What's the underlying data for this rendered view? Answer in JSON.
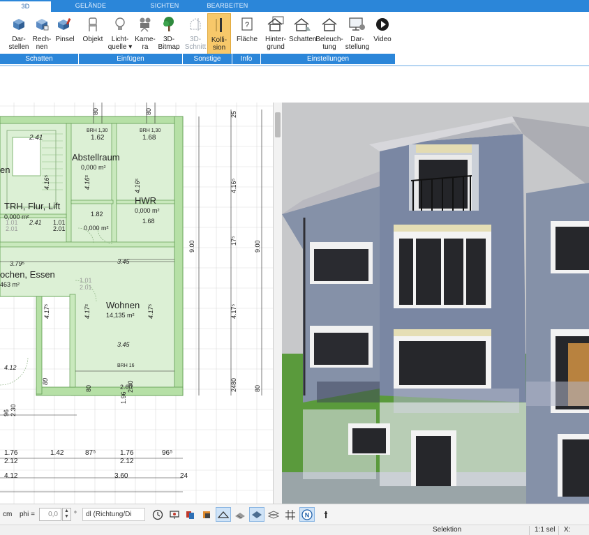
{
  "tabs": [
    {
      "label": "3D",
      "active": true
    },
    {
      "label": "GELÄNDE",
      "active": false
    },
    {
      "label": "SICHTEN",
      "active": false
    },
    {
      "label": "BEARBEITEN",
      "active": false
    }
  ],
  "ribbon": {
    "buttons": {
      "darstellen": {
        "label": "Dar-\nstellen",
        "icon": "cube-icon"
      },
      "rechnen": {
        "label": "Rech-\nnen",
        "icon": "cube-calc-icon"
      },
      "pinsel": {
        "label": "Pinsel",
        "icon": "paint-brush-icon"
      },
      "objekt": {
        "label": "Objekt",
        "icon": "chair-icon"
      },
      "lichtquelle": {
        "label": "Licht-\nquelle ▾",
        "icon": "lightbulb-icon"
      },
      "kamera": {
        "label": "Kame-\nra",
        "icon": "camera-icon"
      },
      "bitmap": {
        "label": "3D-\nBitmap",
        "icon": "tree-icon"
      },
      "schnitt": {
        "label": "3D-\nSchnitt",
        "icon": "section-icon"
      },
      "kollision": {
        "label": "Kolli-\nsion",
        "icon": "collision-icon"
      },
      "flaeche": {
        "label": "Fläche",
        "icon": "area-question-icon"
      },
      "hintergrund": {
        "label": "Hinter-\ngrund",
        "icon": "house-background-icon"
      },
      "schatten": {
        "label": "Schatten",
        "icon": "house-shadow-icon"
      },
      "beleuchtung": {
        "label": "Beleuch-\ntung",
        "icon": "house-light-icon"
      },
      "darstellung": {
        "label": "Dar-\nstellung",
        "icon": "monitor-settings-icon"
      },
      "video": {
        "label": "Video",
        "icon": "play-icon"
      }
    },
    "groups": {
      "schatten": "Schatten",
      "einfuegen": "Einfügen",
      "sonstige": "Sonstige",
      "info": "Info",
      "einstellungen": "Einstellungen"
    }
  },
  "plan": {
    "rooms": [
      {
        "name": "Abstellraum",
        "area": "0,000 m²"
      },
      {
        "name": "TRH, Flur, Lift",
        "area": "0,000 m²"
      },
      {
        "name": "HWR",
        "area": "0,000 m²"
      },
      {
        "name": "ochen, Essen",
        "area": "463 m²"
      },
      {
        "name": "Wohnen",
        "area": "14,135 m²"
      },
      {
        "name": "en",
        "area": ""
      }
    ],
    "dims": {
      "d_241": "2.41",
      "d_162": "1.62",
      "d_168a": "1.68",
      "brh_top1": "BRH 1,30",
      "brh_top2": "BRH 1,30",
      "d_80a": "80",
      "d_80b": "80",
      "d_25": "25",
      "d_416a": "4.16⁵",
      "d_416b": "4.16⁵",
      "d_416c": "4.16⁵",
      "d_416d": "4.16⁵",
      "d_101a": "1.01",
      "d_201a": "2.01",
      "d_241b": "2.41",
      "d_101b": "1.01",
      "d_201b": "2.01",
      "d_168b": "1.68",
      "d_182": "1.82",
      "d_000": "0,000 m²",
      "d_379": "3.79⁵",
      "d_345a": "3.45",
      "d_345b": "3.45",
      "d_101c": "1.01",
      "d_201c": "2.01",
      "d_417a": "4.17⁵",
      "d_417b": "4.17⁵",
      "d_417c": "4.17⁵",
      "d_417d": "4.17⁵",
      "d_900a": "9.00",
      "d_900b": "9.00",
      "d_17": "17⁵",
      "d_412a": "4.12",
      "brh_bot": "BRH 16",
      "d_80c": "80",
      "d_80d": "80",
      "d_2480": "2480",
      "d_80e": "80",
      "d_260": "2.60",
      "d_196": "1.96",
      "d_230": "2.30",
      "d_96": "96",
      "d_230b": "2.30",
      "d_176a": "1.76",
      "d_142": "1.42",
      "d_87": "87⁵",
      "d_176b": "1.76",
      "d_96b": "96⁵",
      "d_212a": "2.12",
      "d_212b": "2.12",
      "d_412b": "4.12",
      "d_360": "3.60",
      "d_24": "24"
    }
  },
  "bottom": {
    "unit": "cm",
    "phi_label": "phi =",
    "phi_value": "0,0",
    "degree": "°",
    "dl_dropdown": "dl (Richtung/Di"
  },
  "status": {
    "mode": "Selektion",
    "scale": "1:1 sel",
    "x_label": "X:"
  },
  "colors": {
    "accent": "#2b86d9",
    "room_fill": "#dcf0d5",
    "wall": "#9ed08c",
    "selected_button": "#f7c86a"
  }
}
